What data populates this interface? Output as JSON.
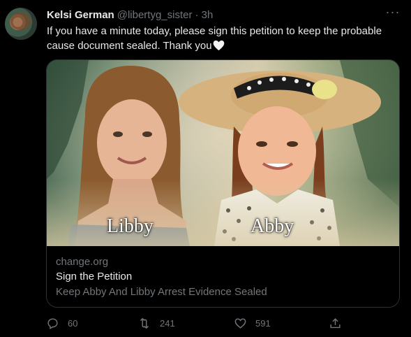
{
  "user": {
    "display_name": "Kelsi German",
    "handle": "@libertyg_sister",
    "timestamp": "· 3h"
  },
  "tweet": {
    "text": "If you have a minute today, please sign this petition to keep the probable cause document sealed. Thank you"
  },
  "card": {
    "image_caption_left": "Libby",
    "image_caption_right": "Abby",
    "domain": "change.org",
    "title": "Sign the Petition",
    "description": "Keep Abby And Libby Arrest Evidence Sealed"
  },
  "actions": {
    "replies": "60",
    "retweets": "241",
    "likes": "591"
  },
  "icons": {
    "more": "more-icon",
    "reply": "reply-icon",
    "retweet": "retweet-icon",
    "like": "heart-icon",
    "share": "share-icon",
    "emoji": "white-heart-emoji"
  },
  "colors": {
    "background": "#000000",
    "text": "#e7e9ea",
    "muted": "#71767b",
    "border": "#2f3336"
  }
}
